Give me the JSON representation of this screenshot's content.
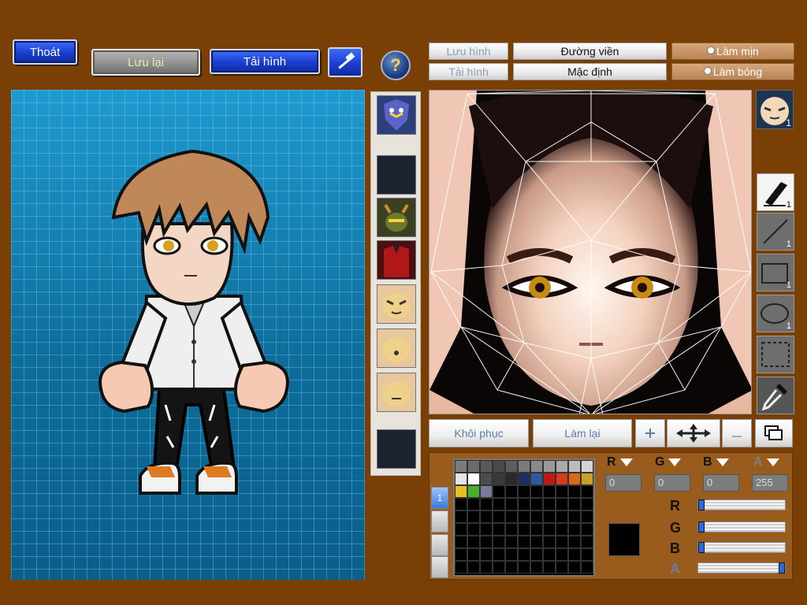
{
  "toolbar": {
    "exit_label": "Thoát",
    "save_label": "Lưu lại",
    "load_label": "Tải hình",
    "hammer_icon": "hammer-icon",
    "help_icon": "help-icon",
    "help_glyph": "?"
  },
  "editor_top": {
    "save_image": "Lưu hình",
    "load_image": "Tải hình",
    "outline": "Đường viền",
    "default": "Mặc định",
    "smooth": "Làm mịn",
    "shade": "Làm bóng"
  },
  "tools": [
    {
      "name": "pen-tool",
      "count": "1"
    },
    {
      "name": "line-tool",
      "count": "1"
    },
    {
      "name": "rectangle-tool",
      "count": "1"
    },
    {
      "name": "ellipse-tool",
      "count": "1"
    },
    {
      "name": "select-tool",
      "count": ""
    },
    {
      "name": "eyedropper-tool",
      "count": ""
    }
  ],
  "avatar_badge": "1",
  "bottom_bar": {
    "restore": "Khôi phục",
    "redo": "Làm lại"
  },
  "color": {
    "r_label": "R",
    "g_label": "G",
    "b_label": "B",
    "a_label": "A",
    "r_value": "0",
    "g_value": "0",
    "b_value": "0",
    "a_value": "255",
    "current": "#000000"
  },
  "layer_tab_label": "1",
  "palette": [
    "#7c7c7c",
    "#6c6c6c",
    "#5a5a5a",
    "#4a4a4a",
    "#5e5e5e",
    "#7a7a7a",
    "#8a8a8a",
    "#9a9a9a",
    "#aaaaaa",
    "#bcbcbc",
    "#d4d4d4",
    "#e6e6e6",
    "#ffffff",
    "#4c4c4c",
    "#3a3a3a",
    "#2a2a2a",
    "#1e2e60",
    "#2d5aa0",
    "#c01818",
    "#d83a1c",
    "#d86a1c",
    "#c8a02c",
    "#e8c020",
    "#48b030",
    "#7a7a9a",
    "#000000",
    "#000000",
    "#000000",
    "#000000",
    "#000000",
    "#000000",
    "#000000",
    "#000000"
  ]
}
